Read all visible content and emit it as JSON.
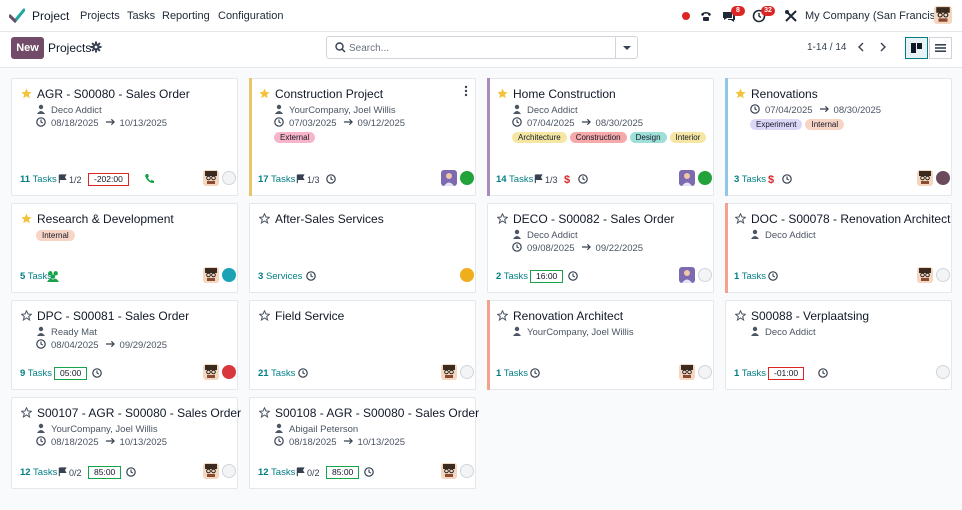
{
  "app": {
    "name": "Project",
    "menu": [
      "Projects",
      "Tasks",
      "Reporting",
      "Configuration"
    ],
    "company": "My Company (San Francisco)",
    "badges": {
      "messages": "8",
      "activities": "32"
    }
  },
  "control": {
    "new_label": "New",
    "title": "Projects",
    "search_placeholder": "Search...",
    "pager": "1-14 / 14"
  },
  "colors": {
    "primary": "#714b67",
    "link": "#017e84",
    "star": "#f3c13a"
  },
  "cards": [
    {
      "title": "AGR - S00080 - Sales Order",
      "fav": true,
      "customer": "Deco Addict",
      "dates": [
        "08/18/2025",
        "10/13/2025"
      ],
      "tasks": "11",
      "tasks_word": "Tasks",
      "milestone": "1/2",
      "time": "-202:00",
      "time_kind": "neg",
      "extra": "phone",
      "avatar": true,
      "status": "none"
    },
    {
      "title": "Construction Project",
      "fav": true,
      "color": "#e9c46a",
      "customer": "YourCompany, Joel Willis",
      "dates": [
        "07/03/2025",
        "09/12/2025"
      ],
      "tags": [
        {
          "label": "External",
          "bg": "#f8b4c8"
        }
      ],
      "tasks": "17",
      "tasks_word": "Tasks",
      "milestone": "1/3",
      "clock": true,
      "avatar": "user2",
      "status": "green",
      "kebab": true
    },
    {
      "title": "Home Construction",
      "fav": true,
      "color": "#a78bbf",
      "customer": "Deco Addict",
      "dates": [
        "07/04/2025",
        "08/30/2025"
      ],
      "tags": [
        {
          "label": "Architecture",
          "bg": "#f5e7a3"
        },
        {
          "label": "Construction",
          "bg": "#f6a9a9"
        },
        {
          "label": "Design",
          "bg": "#9ee0d8"
        },
        {
          "label": "Interior",
          "bg": "#f5e7a3"
        }
      ],
      "tasks": "14",
      "tasks_word": "Tasks",
      "milestone": "1/3",
      "dollar": true,
      "clock": true,
      "avatar": "user2",
      "status": "green"
    },
    {
      "title": "Renovations",
      "fav": true,
      "color": "#93c5e8",
      "dates": [
        "07/04/2025",
        "08/30/2025"
      ],
      "tags": [
        {
          "label": "Experiment",
          "bg": "#dcd6f7"
        },
        {
          "label": "Internal",
          "bg": "#f8d4c4"
        }
      ],
      "tasks": "3",
      "tasks_word": "Tasks",
      "dollar": true,
      "clock": true,
      "avatar": true,
      "status": "purple"
    },
    {
      "title": "Research & Development",
      "fav": true,
      "tags": [
        {
          "label": "Internal",
          "bg": "#f8d4c4"
        }
      ],
      "tasks": "5",
      "tasks_word": "Tasks",
      "extra": "team",
      "avatar": true,
      "status": "teal"
    },
    {
      "title": "After-Sales Services",
      "fav": false,
      "tasks": "3",
      "tasks_word": "Services",
      "clock": true,
      "status": "yellow"
    },
    {
      "title": "DECO - S00082 - Sales Order",
      "fav": false,
      "customer": "Deco Addict",
      "dates": [
        "09/08/2025",
        "09/22/2025"
      ],
      "tasks": "2",
      "tasks_word": "Tasks",
      "time": "16:00",
      "time_kind": "pos",
      "clock": true,
      "avatar": "user2",
      "status": "none"
    },
    {
      "title": "DOC - S00078 - Renovation Architect",
      "fav": false,
      "color": "#f4a28c",
      "customer": "Deco Addict",
      "tasks": "1",
      "tasks_word": "Tasks",
      "clock": true,
      "avatar": true,
      "status": "none"
    },
    {
      "title": "DPC - S00081 - Sales Order",
      "fav": false,
      "customer": "Ready Mat",
      "dates": [
        "08/04/2025",
        "09/29/2025"
      ],
      "tasks": "9",
      "tasks_word": "Tasks",
      "time": "05:00",
      "time_kind": "pos",
      "clock": true,
      "avatar": true,
      "status": "red"
    },
    {
      "title": "Field Service",
      "fav": false,
      "tasks": "21",
      "tasks_word": "Tasks",
      "clock": true,
      "avatar": true,
      "status": "none"
    },
    {
      "title": "Renovation Architect",
      "fav": false,
      "color": "#f4a28c",
      "customer": "YourCompany, Joel Willis",
      "tasks": "1",
      "tasks_word": "Tasks",
      "clock": true,
      "avatar": true,
      "status": "none"
    },
    {
      "title": "S00088 - Verplaatsing",
      "fav": false,
      "customer": "Deco Addict",
      "tasks": "1",
      "tasks_word": "Tasks",
      "time": "-01:00",
      "time_kind": "neg",
      "clock": true,
      "status": "none"
    },
    {
      "title": "S00107 - AGR - S00080 - Sales Order",
      "fav": false,
      "customer": "YourCompany, Joel Willis",
      "dates": [
        "08/18/2025",
        "10/13/2025"
      ],
      "tasks": "12",
      "tasks_word": "Tasks",
      "milestone": "0/2",
      "time": "85:00",
      "time_kind": "pos",
      "clock": true,
      "avatar": true,
      "status": "none"
    },
    {
      "title": "S00108 - AGR - S00080 - Sales Order",
      "fav": false,
      "customer": "Abigail Peterson",
      "dates": [
        "08/18/2025",
        "10/13/2025"
      ],
      "tasks": "12",
      "tasks_word": "Tasks",
      "milestone": "0/2",
      "time": "85:00",
      "time_kind": "pos",
      "clock": true,
      "avatar": true,
      "status": "none"
    }
  ]
}
